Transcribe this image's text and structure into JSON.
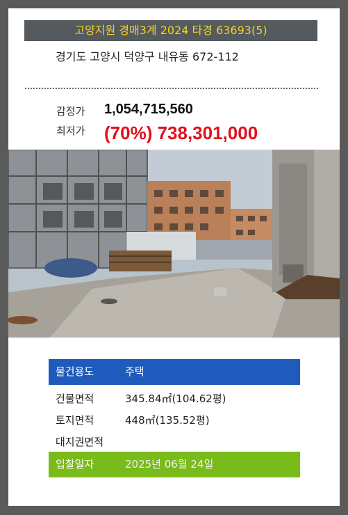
{
  "header": {
    "title": "고양지원 경매3계 2024 타경 63693(5)",
    "address": "경기도 고양시 덕양구 내유동 672-112"
  },
  "prices": {
    "appraisal_label": "감정가",
    "appraisal_value": "1,054,715,560",
    "minimum_label": "최저가",
    "minimum_value": "(70%) 738,301,000"
  },
  "details": {
    "usage_label": "물건용도",
    "usage_value": "주택",
    "building_area_label": "건물면적",
    "building_area_value": "345.84㎡(104.62평)",
    "land_area_label": "토지면적",
    "land_area_value": "448㎡(135.52평)",
    "land_right_label": "대지권면적",
    "land_right_value": "",
    "bid_date_label": "입찰일자",
    "bid_date_value": "2025년 06월 24일"
  },
  "colors": {
    "title_bg": "#545a5e",
    "title_text": "#f2d22a",
    "minimum_price": "#e0101a",
    "usage_row": "#1e5bbd",
    "bid_row": "#79bb1b"
  }
}
